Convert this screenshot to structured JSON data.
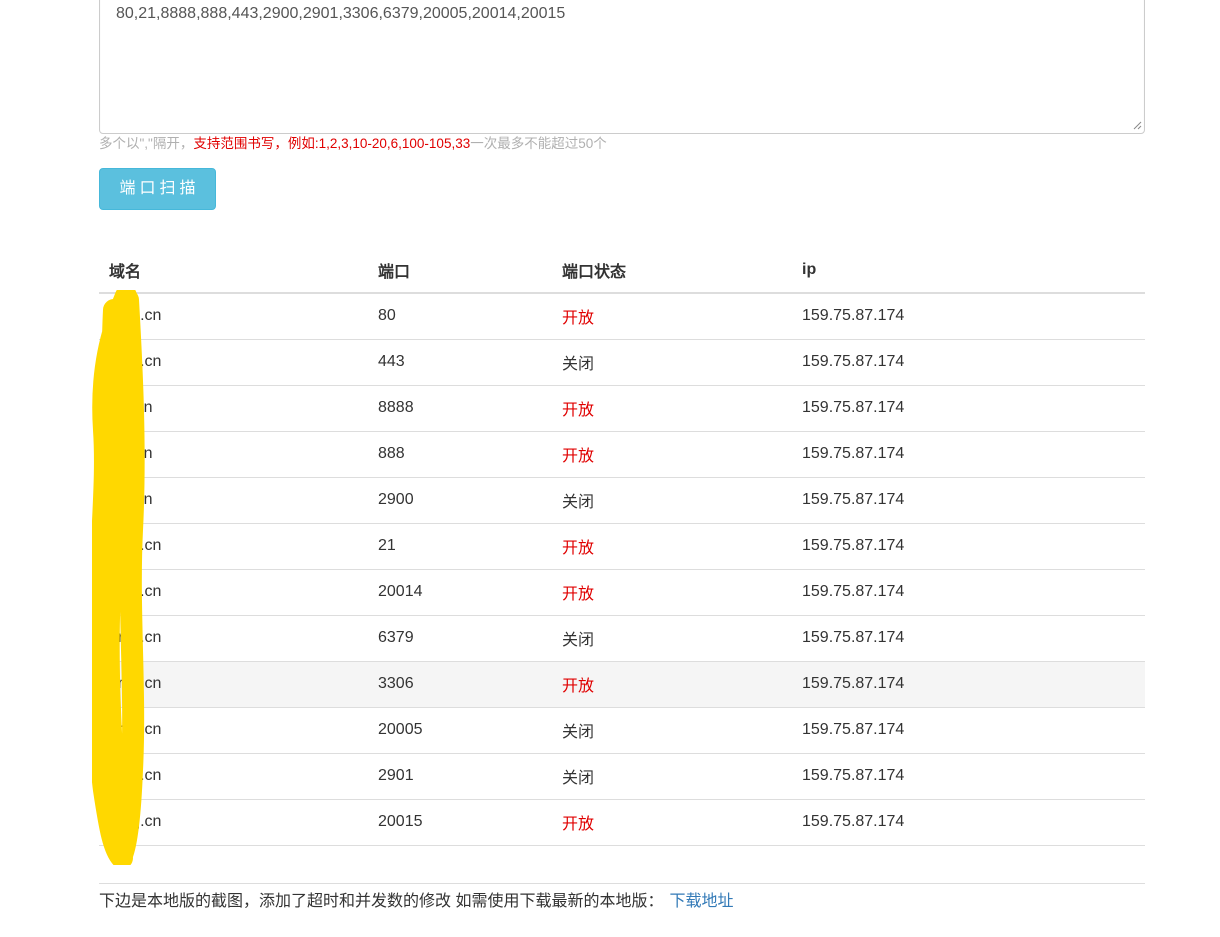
{
  "ports_input": {
    "value": "80,21,8888,888,443,2900,2901,3306,6379,20005,20014,20015"
  },
  "help_text": {
    "muted_before": "多个以\",\"隔开，",
    "highlight": "支持范围书写，例如:1,2,3,10-20,6,100-105,33",
    "muted_after": "一次最多不能超过50个"
  },
  "scan_button_label": "端口扫描",
  "table": {
    "headers": {
      "domain": "域名",
      "port": "端口",
      "status": "端口状态",
      "ip": "ip"
    },
    "rows": [
      {
        "domain": "drrkj.cn",
        "port": "80",
        "status": "开放",
        "open": true,
        "ip": "159.75.87.174"
      },
      {
        "domain": "drrkj.cn",
        "port": "443",
        "status": "关闭",
        "open": false,
        "ip": "159.75.87.174"
      },
      {
        "domain": "rrkj.cn",
        "port": "8888",
        "status": "开放",
        "open": true,
        "ip": "159.75.87.174"
      },
      {
        "domain": "rrkj.cn",
        "port": "888",
        "status": "开放",
        "open": true,
        "ip": "159.75.87.174"
      },
      {
        "domain": "rrkj.cn",
        "port": "2900",
        "status": "关闭",
        "open": false,
        "ip": "159.75.87.174"
      },
      {
        "domain": "drrkj.cn",
        "port": "21",
        "status": "开放",
        "open": true,
        "ip": "159.75.87.174"
      },
      {
        "domain": "drrkj.cn",
        "port": "20014",
        "status": "开放",
        "open": true,
        "ip": "159.75.87.174"
      },
      {
        "domain": "drrkj.cn",
        "port": "6379",
        "status": "关闭",
        "open": false,
        "ip": "159.75.87.174"
      },
      {
        "domain": "drrkj.cn",
        "port": "3306",
        "status": "开放",
        "open": true,
        "ip": "159.75.87.174"
      },
      {
        "domain": "drrkj.cn",
        "port": "20005",
        "status": "关闭",
        "open": false,
        "ip": "159.75.87.174"
      },
      {
        "domain": "drrkj.cn",
        "port": "2901",
        "status": "关闭",
        "open": false,
        "ip": "159.75.87.174"
      },
      {
        "domain": "drrkj.cn",
        "port": "20015",
        "status": "开放",
        "open": true,
        "ip": "159.75.87.174"
      }
    ]
  },
  "footer": {
    "text": "下边是本地版的截图，添加了超时和并发数的修改 如需使用下载最新的本地版：",
    "link_label": "下载地址"
  },
  "colors": {
    "open_status": "#e00000",
    "button": "#5bc0de",
    "link": "#337ab7",
    "redaction_marker": "#ffd800"
  }
}
